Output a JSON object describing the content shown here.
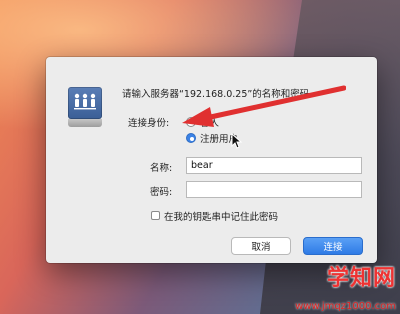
{
  "dialog": {
    "title": "请输入服务器“192.168.0.25”的名称和密码。",
    "connect_as_label": "连接身份:",
    "options": [
      {
        "label": "客人",
        "selected": false
      },
      {
        "label": "注册用户",
        "selected": true
      }
    ],
    "name_label": "名称:",
    "name_value": "bear",
    "password_label": "密码:",
    "password_value": "",
    "keychain_label": "在我的钥匙串中记住此密码",
    "keychain_checked": false,
    "cancel_label": "取消",
    "connect_label": "连接"
  },
  "watermark": {
    "logo_text": "学知网",
    "url": "www.jmqz1000.com"
  },
  "colors": {
    "accent": "#2f7be6",
    "annotation": "#e03030"
  }
}
